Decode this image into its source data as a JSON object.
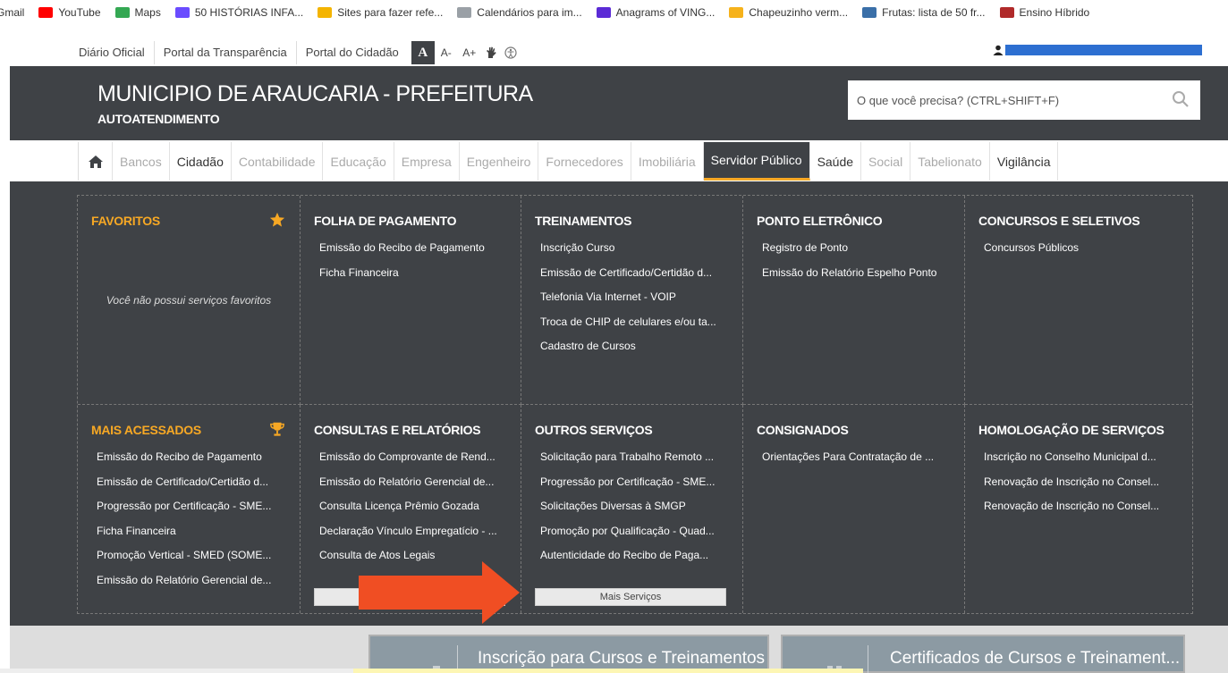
{
  "bookmarks": [
    {
      "label": "Gmail",
      "color": "#ffffff"
    },
    {
      "label": "YouTube",
      "color": "#ff0000"
    },
    {
      "label": "Maps",
      "color": "#34a853"
    },
    {
      "label": "50 HISTÓRIAS INFA...",
      "color": "#6a4cff"
    },
    {
      "label": "Sites para fazer refe...",
      "color": "#f4b400"
    },
    {
      "label": "Calendários para im...",
      "color": "#9aa0a6"
    },
    {
      "label": "Anagrams of VING...",
      "color": "#5b2bd6"
    },
    {
      "label": "Chapeuzinho verm...",
      "color": "#f6b21b"
    },
    {
      "label": "Frutas: lista de 50 fr...",
      "color": "#3a6fa8"
    },
    {
      "label": "Ensino Híbrido",
      "color": "#b02a2a"
    }
  ],
  "util": {
    "links": [
      "Diário Oficial",
      "Portal da Transparência",
      "Portal do Cidadão"
    ],
    "font_buttons": [
      "A",
      "A-",
      "A+"
    ]
  },
  "header": {
    "title": "MUNICIPIO DE ARAUCARIA - PREFEITURA",
    "subtitle": "AUTOATENDIMENTO",
    "search_placeholder": "O que você precisa? (CTRL+SHIFT+F)"
  },
  "nav": {
    "items": [
      {
        "label": "Bancos",
        "style": "muted"
      },
      {
        "label": "Cidadão",
        "style": "dark"
      },
      {
        "label": "Contabilidade",
        "style": "muted"
      },
      {
        "label": "Educação",
        "style": "muted"
      },
      {
        "label": "Empresa",
        "style": "muted"
      },
      {
        "label": "Engenheiro",
        "style": "muted"
      },
      {
        "label": "Fornecedores",
        "style": "muted"
      },
      {
        "label": "Imobiliária",
        "style": "muted"
      },
      {
        "label": "Servidor Público",
        "style": "active"
      },
      {
        "label": "Saúde",
        "style": "dark"
      },
      {
        "label": "Social",
        "style": "muted"
      },
      {
        "label": "Tabelionato",
        "style": "muted"
      },
      {
        "label": "Vigilância",
        "style": "dark"
      }
    ]
  },
  "sections": {
    "favoritos": {
      "title": "FAVORITOS",
      "empty": "Você não possui serviços favoritos"
    },
    "folha": {
      "title": "FOLHA DE PAGAMENTO",
      "items": [
        "Emissão do Recibo de Pagamento",
        "Ficha Financeira"
      ]
    },
    "treinamentos": {
      "title": "TREINAMENTOS",
      "items": [
        "Inscrição Curso",
        "Emissão de Certificado/Certidão d...",
        "Telefonia Via Internet - VOIP",
        "Troca de CHIP de celulares e/ou ta...",
        "Cadastro de Cursos"
      ]
    },
    "ponto": {
      "title": "PONTO ELETRÔNICO",
      "items": [
        "Registro de Ponto",
        "Emissão do Relatório Espelho Ponto"
      ]
    },
    "concursos": {
      "title": "CONCURSOS E SELETIVOS",
      "items": [
        "Concursos Públicos"
      ]
    },
    "mais_acessados": {
      "title": "MAIS ACESSADOS",
      "items": [
        "Emissão do Recibo de Pagamento",
        "Emissão de Certificado/Certidão d...",
        "Progressão por Certificação - SME...",
        "Ficha Financeira",
        "Promoção Vertical - SMED (SOME...",
        "Emissão do Relatório Gerencial de..."
      ]
    },
    "consultas": {
      "title": "CONSULTAS E RELATÓRIOS",
      "items": [
        "Emissão do Comprovante de Rend...",
        "Emissão do Relatório Gerencial de...",
        "Consulta Licença Prêmio Gozada",
        "Declaração Vínculo Empregatício - ...",
        "Consulta de Atos Legais"
      ]
    },
    "outros": {
      "title": "OUTROS SERVIÇOS",
      "items": [
        "Solicitação para Trabalho Remoto ...",
        "Progressão por Certificação - SME...",
        "Solicitações Diversas à SMGP",
        "Promoção por Qualificação - Quad...",
        "Autenticidade do Recibo de Paga..."
      ],
      "more_label": "Mais Serviços"
    },
    "consignados": {
      "title": "CONSIGNADOS",
      "items": [
        "Orientações Para Contratação de ..."
      ]
    },
    "homologacao": {
      "title": "HOMOLOGAÇÃO DE SERVIÇOS",
      "items": [
        "Inscrição no Conselho Municipal d...",
        "Renovação de Inscrição no Consel...",
        "Renovação de Inscrição no Consel..."
      ]
    }
  },
  "cards": [
    {
      "title": "Inscrição para Cursos e Treinamentos"
    },
    {
      "title": "Certificados de Cursos e Treinament..."
    }
  ],
  "colors": {
    "header_bg": "#3f4246",
    "accent": "#f7a824",
    "arrow": "#f04e23"
  }
}
